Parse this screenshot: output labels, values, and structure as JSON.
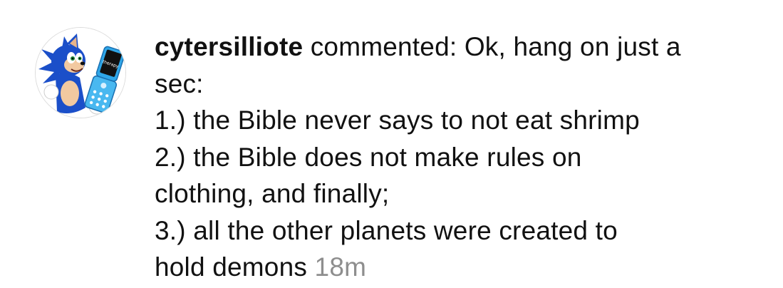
{
  "comment": {
    "username": "cytersilliote",
    "action_text": " commented: ",
    "avatar": {
      "icon": "sonic-holding-phone-avatar-icon",
      "phone_screen_text": "therapy"
    },
    "lines": [
      "Ok, hang on just a",
      "sec:",
      "1.) the Bible never says to not eat shrimp",
      "2.) the Bible does not make rules on",
      "clothing, and finally;",
      "3.) all the other planets were created to",
      "hold demons "
    ],
    "timestamp": "18m"
  },
  "colors": {
    "text": "#111111",
    "timestamp": "#8e8e8e",
    "sonic_blue": "#1b4fc9",
    "phone_blue": "#2fa6e8"
  }
}
